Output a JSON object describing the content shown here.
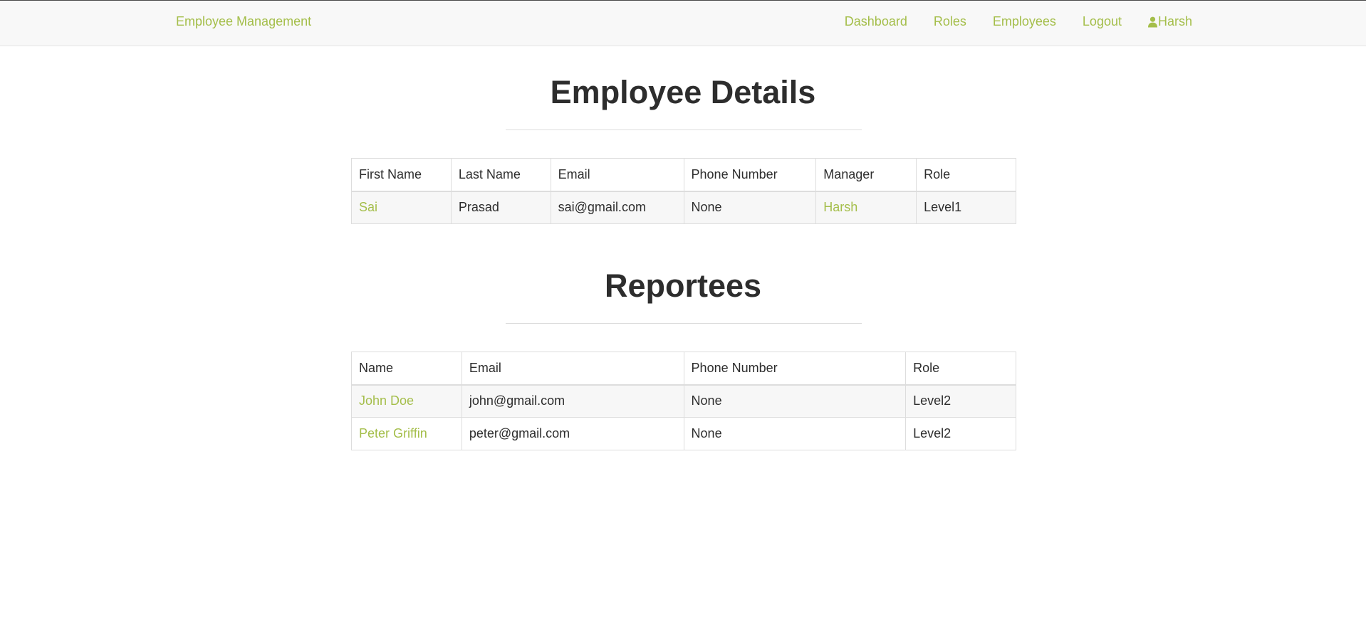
{
  "navbar": {
    "brand": "Employee Management",
    "links": [
      {
        "label": "Dashboard"
      },
      {
        "label": "Roles"
      },
      {
        "label": "Employees"
      },
      {
        "label": "Logout"
      }
    ],
    "user": {
      "icon": "user-icon",
      "label": "Harsh"
    }
  },
  "colors": {
    "accent": "#a4be4a",
    "text": "#2d2d2d",
    "navbar_bg": "#f8f8f8",
    "stripe": "#f7f7f7"
  },
  "details": {
    "title": "Employee Details",
    "headers": [
      "First Name",
      "Last Name",
      "Email",
      "Phone Number",
      "Manager",
      "Role"
    ],
    "row": {
      "first_name": "Sai",
      "last_name": "Prasad",
      "email": "sai@gmail.com",
      "phone": "None",
      "manager": "Harsh",
      "role": "Level1"
    }
  },
  "reportees": {
    "title": "Reportees",
    "headers": [
      "Name",
      "Email",
      "Phone Number",
      "Role"
    ],
    "rows": [
      {
        "name": "John Doe",
        "email": "john@gmail.com",
        "phone": "None",
        "role": "Level2"
      },
      {
        "name": "Peter Griffin",
        "email": "peter@gmail.com",
        "phone": "None",
        "role": "Level2"
      }
    ]
  }
}
